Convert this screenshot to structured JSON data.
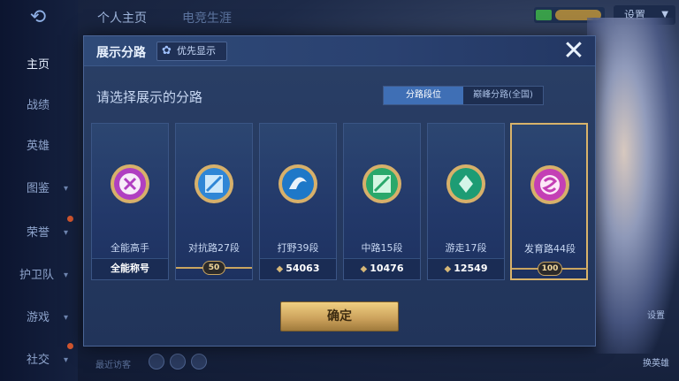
{
  "top_tabs": [
    "个人主页",
    "电竞生涯"
  ],
  "settings_label": "设置",
  "sidebar": [
    {
      "label": "主页"
    },
    {
      "label": "战绩"
    },
    {
      "label": "英雄"
    },
    {
      "label": "图鉴"
    },
    {
      "label": "荣誉"
    },
    {
      "label": "护卫队"
    },
    {
      "label": "游戏"
    },
    {
      "label": "社交"
    }
  ],
  "bottom_left_text": "最近访客",
  "right_buttons": [
    "设置",
    "换英雄"
  ],
  "modal": {
    "title": "展示分路",
    "priority_label": "优先显示",
    "prompt": "请选择展示的分路",
    "seg_tabs": [
      "分路段位",
      "巅峰分路(全国)"
    ],
    "confirm_label": "确定",
    "cards": [
      {
        "label": "全能高手",
        "footer": "全能称号",
        "footer_type": "text",
        "color": "#b03fc1"
      },
      {
        "label": "对抗路27段",
        "footer": "50",
        "footer_type": "rank",
        "color": "#2f86d6"
      },
      {
        "label": "打野39段",
        "footer": "54063",
        "footer_type": "diamond",
        "color": "#1e78c8"
      },
      {
        "label": "中路15段",
        "footer": "10476",
        "footer_type": "diamond",
        "color": "#2aa86b"
      },
      {
        "label": "游走17段",
        "footer": "12549",
        "footer_type": "diamond",
        "color": "#1d9c74"
      },
      {
        "label": "发育路44段",
        "footer": "100",
        "footer_type": "rank",
        "color": "#c43fb5"
      }
    ]
  }
}
